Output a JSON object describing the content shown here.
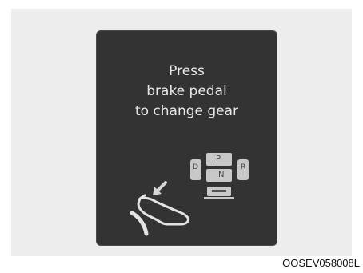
{
  "display": {
    "message_lines": [
      "Press",
      "brake pedal",
      "to change gear"
    ]
  },
  "selector": {
    "park_label": "P",
    "drive_label": "D",
    "neutral_label": "N",
    "reverse_label": "R"
  },
  "figure_id": "OOSEV058008L",
  "icons": {
    "pedal": "brake-pedal-foot-icon",
    "selector": "gear-selector-icon"
  },
  "colors": {
    "screen": "#333333",
    "text": "#e9e9e9",
    "icon": "#d6d6d6"
  }
}
